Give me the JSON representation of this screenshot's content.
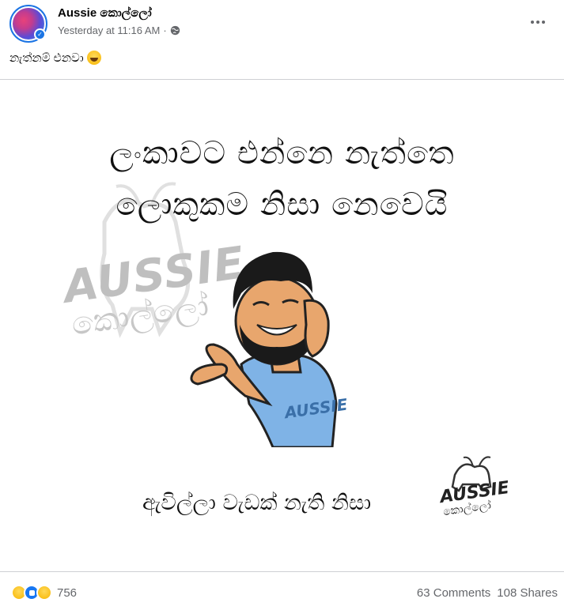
{
  "post": {
    "page_name": "Aussie කොල්ලෝ",
    "timestamp": "Yesterday at 11:16 AM",
    "separator": "·",
    "caption": "නැත්නම් එනවා",
    "caption_emoji": "laughing-emoji"
  },
  "image": {
    "line1": "ලංකාවට එන්නෙ නැත්තෙ",
    "line2": "ලොකුකම නිසා නෙවෙයි",
    "line3": "ඇවිල්ලා වැඩක් නැති නිසා",
    "watermark_text": "AUSSIE",
    "watermark_sub": "කොල්ලෝ",
    "logo_text": "AUSSIE",
    "logo_sub": "කොල්ලෝ"
  },
  "footer": {
    "reactions": [
      "haha",
      "like",
      "sad"
    ],
    "reaction_count": "756",
    "comments": "63 Comments",
    "shares": "108 Shares"
  },
  "colors": {
    "brand_blue": "#1b74e4",
    "text_secondary": "#65676b"
  }
}
